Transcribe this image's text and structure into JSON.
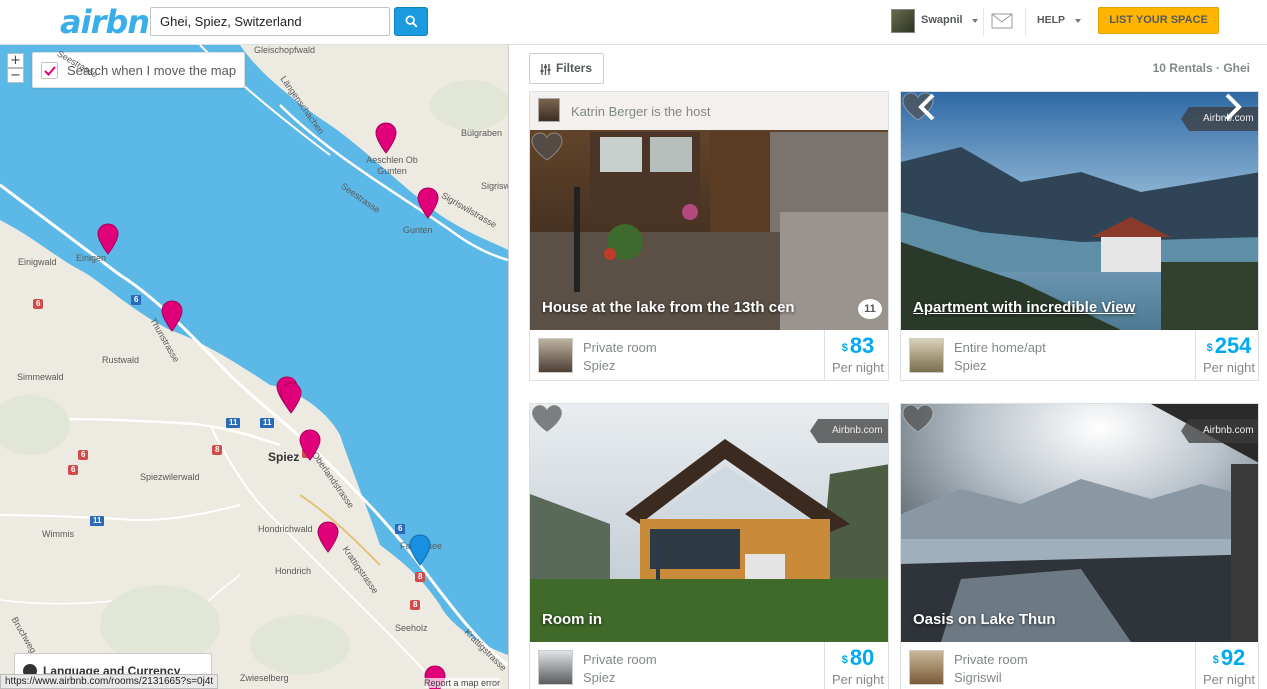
{
  "header": {
    "logo": "airbnb",
    "search": {
      "value": "Ghei, Spiez, Switzerland",
      "placeholder": ""
    },
    "user_name": "Swapnil",
    "help_label": "HELP",
    "list_space_label": "LIST YOUR SPACE"
  },
  "map": {
    "zoom_in": "+",
    "zoom_out": "−",
    "toggle_label": "Search when I move the map",
    "toggle_checked": true,
    "places": [
      "Gleischopfwald",
      "Längenschachen",
      "Bülgraben",
      "Aeschlen Ob Gunten",
      "Seestrasse",
      "Sigriswil",
      "Sigriswilstrasse",
      "Gunten",
      "Einigwald",
      "Einigen",
      "Thunstrasse",
      "Rustwald",
      "Simmewald",
      "Spiez",
      "Oberlandstrasse",
      "Spiezwilerwald",
      "Wimmis",
      "Hondrichwald",
      "Hondrich",
      "Krattigstrasse",
      "Faulensee",
      "Seeholz",
      "Krattigstrasse",
      "Bruchweg",
      "Zwieselberg",
      "Seestrasse"
    ],
    "road_signs": [
      "6",
      "6",
      "6",
      "11",
      "11",
      "8",
      "8",
      "6",
      "11",
      "6",
      "8",
      "8"
    ],
    "language_label": "Language and Currency",
    "report_label": "Report a map error"
  },
  "status_url": "https://www.airbnb.com/rooms/2131665?s=0j4t",
  "results": {
    "filters_label": "Filters",
    "rental_count": "10 Rentals · Ghei",
    "listings": [
      {
        "title": "House at the lake from the 13th cen",
        "host_strip": "Katrin Berger is the host",
        "reviews": "11",
        "room_type": "Private room",
        "location": "Spiez",
        "currency": "$",
        "price": "83",
        "per_night": "Per night"
      },
      {
        "title": "Apartment with incredible View",
        "badge": "Airbnb.com",
        "room_type": "Entire home/apt",
        "location": "Spiez",
        "currency": "$",
        "price": "254",
        "per_night": "Per night"
      },
      {
        "title": "Room in",
        "badge": "Airbnb.com",
        "room_type": "Private room",
        "location": "Spiez",
        "currency": "$",
        "price": "80",
        "per_night": "Per night"
      },
      {
        "title": "Oasis on Lake Thun",
        "badge": "Airbnb.com",
        "room_type": "Private room",
        "location": "Sigriswil",
        "currency": "$",
        "price": "92",
        "per_night": "Per night"
      }
    ]
  },
  "colors": {
    "brand": "#3aaeea",
    "accent": "#ffb400",
    "price": "#00aaf0",
    "pin": "#e0007a",
    "pin_active": "#1a8fe0",
    "lake": "#5cb8e6"
  }
}
